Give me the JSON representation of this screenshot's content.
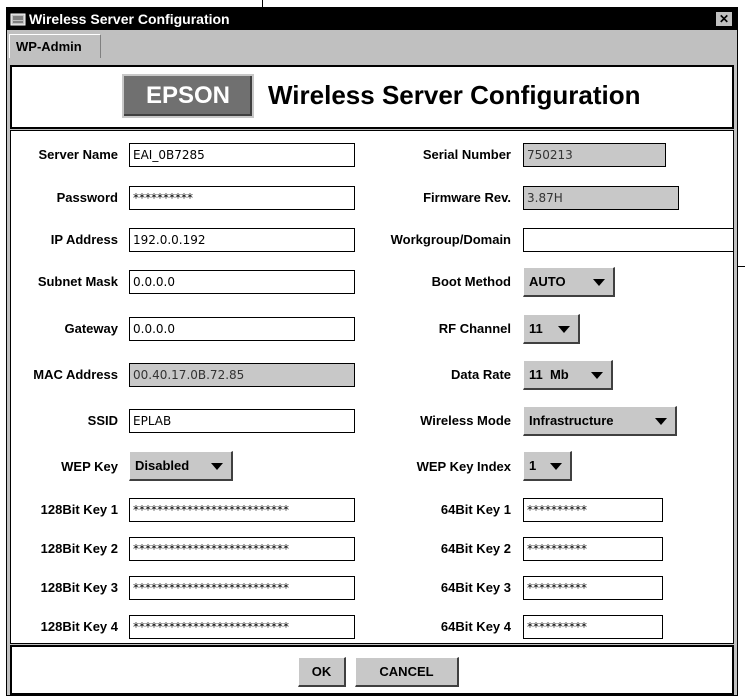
{
  "window": {
    "title": "Wireless Server Configuration",
    "close_glyph": "✕",
    "icon": "app-icon"
  },
  "tabs": [
    {
      "label": "WP-Admin"
    }
  ],
  "header": {
    "logo_text": "EPSON",
    "title": "Wireless Server Configuration"
  },
  "left": {
    "server_name": {
      "label": "Server Name",
      "value": "EAI_0B7285"
    },
    "password": {
      "label": "Password",
      "value": "**********"
    },
    "ip_address": {
      "label": "IP Address",
      "value": "192.0.0.192"
    },
    "subnet_mask": {
      "label": "Subnet Mask",
      "value": "0.0.0.0"
    },
    "gateway": {
      "label": "Gateway",
      "value": "0.0.0.0"
    },
    "mac_address": {
      "label": "MAC Address",
      "value": "00.40.17.0B.72.85"
    },
    "ssid": {
      "label": "SSID",
      "value": "EPLAB"
    },
    "wep_key": {
      "label": "WEP Key",
      "value": "Disabled"
    },
    "key128_1": {
      "label": "128Bit Key 1",
      "value": "**************************"
    },
    "key128_2": {
      "label": "128Bit Key 2",
      "value": "**************************"
    },
    "key128_3": {
      "label": "128Bit Key 3",
      "value": "**************************"
    },
    "key128_4": {
      "label": "128Bit Key 4",
      "value": "**************************"
    }
  },
  "right": {
    "serial_number": {
      "label": "Serial Number",
      "value": "750213"
    },
    "firmware_rev": {
      "label": "Firmware Rev.",
      "value": "3.87H"
    },
    "workgroup": {
      "label": "Workgroup/Domain",
      "value": ""
    },
    "boot_method": {
      "label": "Boot Method",
      "value": "AUTO"
    },
    "rf_channel": {
      "label": "RF Channel",
      "value": "11"
    },
    "data_rate": {
      "label": "Data Rate",
      "value": "11  Mb"
    },
    "wireless_mode": {
      "label": "Wireless Mode",
      "value": "Infrastructure"
    },
    "wep_key_index": {
      "label": "WEP Key Index",
      "value": "1"
    },
    "key64_1": {
      "label": "64Bit Key 1",
      "value": "**********"
    },
    "key64_2": {
      "label": "64Bit Key 2",
      "value": "**********"
    },
    "key64_3": {
      "label": "64Bit Key 3",
      "value": "**********"
    },
    "key64_4": {
      "label": "64Bit Key 4",
      "value": "**********"
    }
  },
  "footer": {
    "ok_label": "OK",
    "cancel_label": "CANCEL"
  },
  "colors": {
    "titlebar": "#000000",
    "panel": "#c0c0c0",
    "readonly": "#c8c8c8",
    "logo": "#707070"
  }
}
